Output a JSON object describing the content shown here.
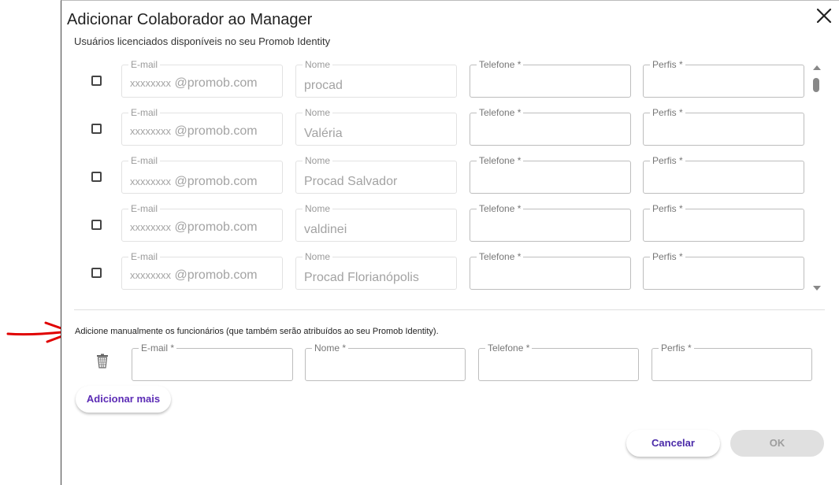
{
  "dialog": {
    "title": "Adicionar Colaborador ao Manager",
    "subtitle": "Usuários licenciados disponíveis no seu Promob Identity",
    "close_icon": "close-icon"
  },
  "licensed_users": {
    "labels": {
      "email": "E-mail",
      "name": "Nome",
      "phone": "Telefone *",
      "profiles": "Perfis *"
    },
    "rows": [
      {
        "email_masked": "xxxxxxxx",
        "email_domain": " @promob.com",
        "name": "procad",
        "phone": "",
        "profiles": "",
        "checked": false
      },
      {
        "email_masked": "xxxxxxxx",
        "email_domain": " @promob.com",
        "name": "Valéria",
        "phone": "",
        "profiles": "",
        "checked": false
      },
      {
        "email_masked": "xxxxxxxx",
        "email_domain": " @promob.com",
        "name": "Procad  Salvador",
        "phone": "",
        "profiles": "",
        "checked": false
      },
      {
        "email_masked": "xxxxxxxx",
        "email_domain": " @promob.com",
        "name": "valdinei",
        "phone": "",
        "profiles": "",
        "checked": false
      },
      {
        "email_masked": "xxxxxxxx",
        "email_domain": " @promob.com",
        "name": "Procad  Florianópolis",
        "phone": "",
        "profiles": "",
        "checked": false
      }
    ]
  },
  "manual": {
    "instruction": "Adicione manualmente os funcionários (que também serão atribuídos ao seu Promob Identity).",
    "labels": {
      "email": "E-mail *",
      "name": "Nome *",
      "phone": "Telefone *",
      "profiles": "Perfis *"
    },
    "values": {
      "email": "",
      "name": "",
      "phone": "",
      "profiles": ""
    },
    "delete_icon": "trash-icon",
    "add_more_label": "Adicionar mais"
  },
  "footer": {
    "cancel_label": "Cancelar",
    "ok_label": "OK"
  },
  "colors": {
    "accent": "#5b2bb5",
    "annotation_arrow": "#e00000",
    "disabled_button": "#e0e0e0"
  }
}
